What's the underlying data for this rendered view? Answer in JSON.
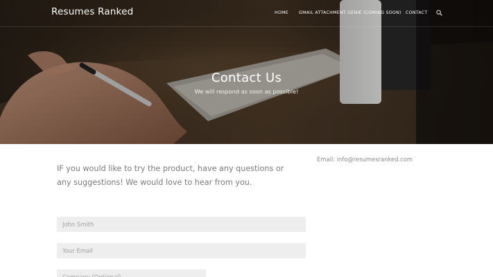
{
  "header": {
    "brand": "Resumes Ranked",
    "nav": {
      "home": "HOME",
      "genie": "GMAIL ATTACHMENT GENIE (COMING SOON)",
      "contact": "CONTACT"
    },
    "search_icon": "search-icon"
  },
  "hero": {
    "title": "Contact Us",
    "subtitle": "We will respond as soon as possible!"
  },
  "content": {
    "intro": "IF you would like to try the product, have any questions or any suggestions!  We would love to hear from you.",
    "side_email": "Email: info@resumesranked.com"
  },
  "form": {
    "name_placeholder": "John Smith",
    "email_placeholder": "Your Email",
    "company_placeholder": "Company (Optional)"
  }
}
